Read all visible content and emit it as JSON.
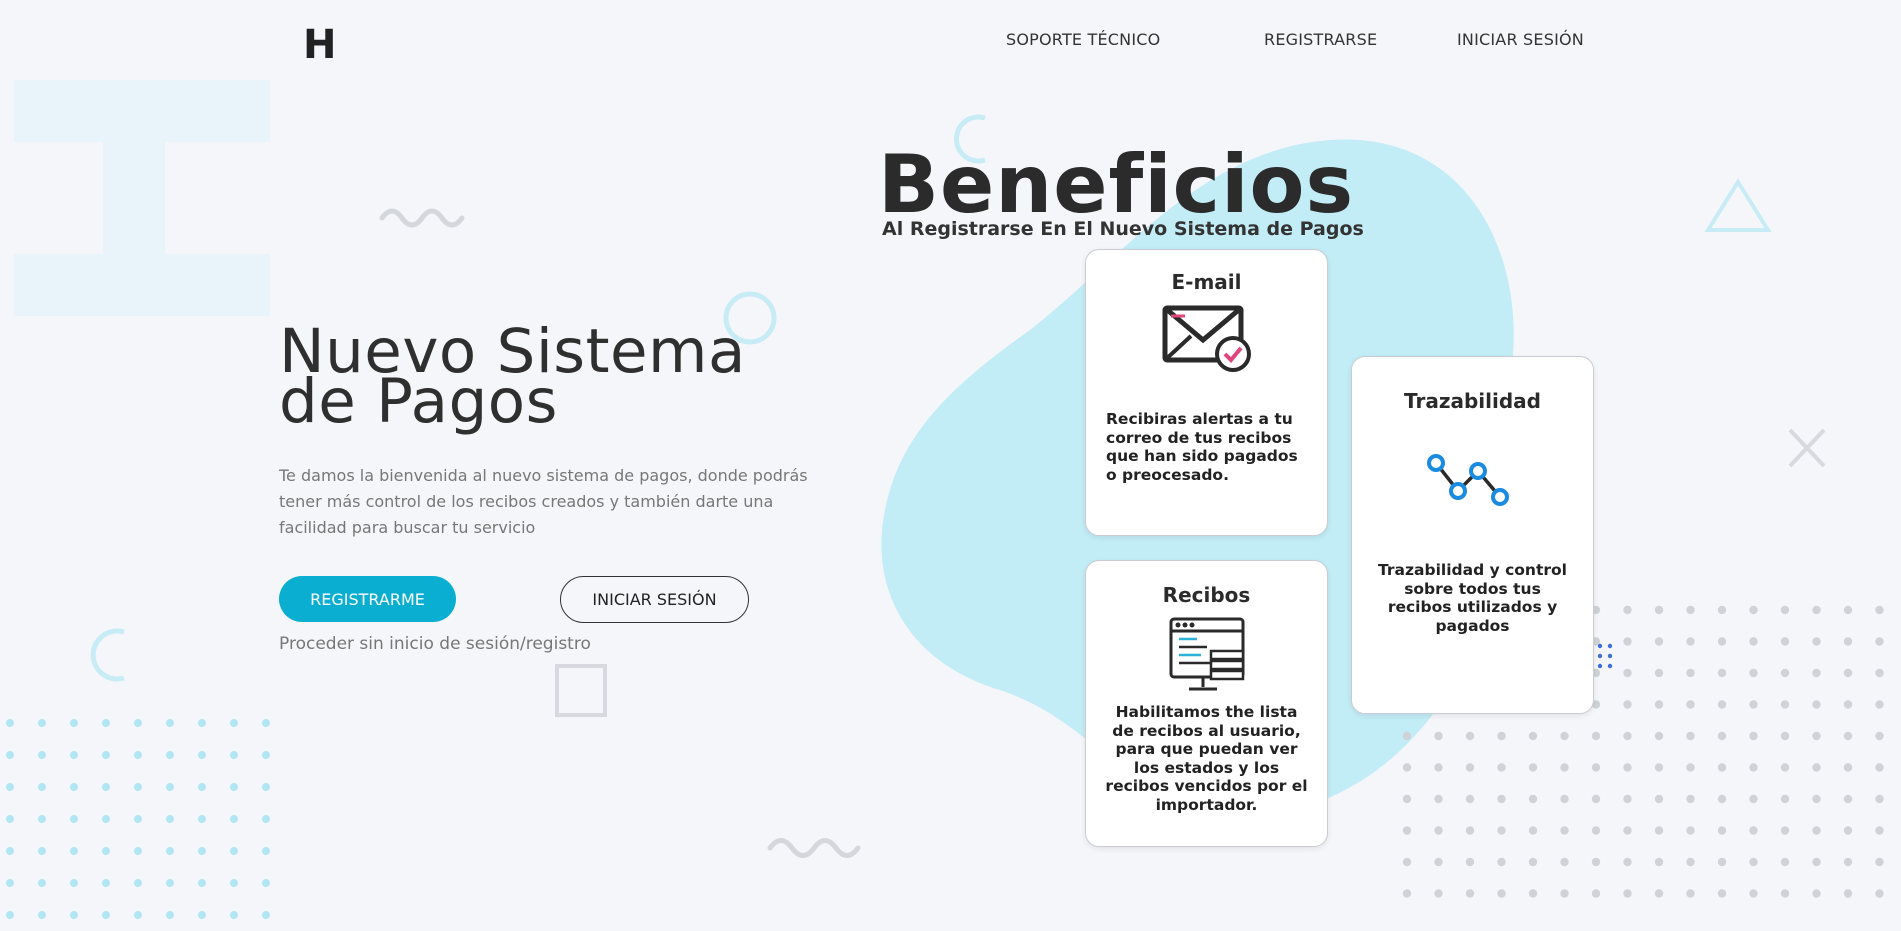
{
  "header": {
    "logo": "H",
    "nav": [
      {
        "label": "SOPORTE TÉCNICO"
      },
      {
        "label": "REGISTRARSE"
      },
      {
        "label": "INICIAR SESIÓN"
      }
    ]
  },
  "hero": {
    "title_line1": "Nuevo Sistema",
    "title_line2": "de Pagos",
    "description": "Te damos la bienvenida al nuevo sistema de pagos, donde podrás tener más control de los recibos creados y también darte una facilidad para buscar tu servicio",
    "primary_button": "REGISTRARME",
    "secondary_button": "INICIAR SESIÓN",
    "proceed_link": "Proceder sin inicio de sesión/registro"
  },
  "benefits": {
    "title": "Beneficios",
    "subtitle": "Al Registrarse En El Nuevo Sistema de Pagos",
    "cards": [
      {
        "title": "E-mail",
        "icon": "email-check-icon",
        "text": "Recibiras alertas a tu correo de tus recibos que han sido pagados o preocesado."
      },
      {
        "title": "Trazabilidad",
        "icon": "trace-line-icon",
        "text": "Trazabilidad y control sobre todos tus recibos utilizados y pagados"
      },
      {
        "title": "Recibos",
        "icon": "receipts-monitor-icon",
        "text": "Habilitamos the lista de recibos al usuario, para que puedan ver los estados y los recibos vencidos por el importador."
      }
    ]
  },
  "colors": {
    "accent": "#0aaed1",
    "blob": "#c2ecf6",
    "background": "#f5f6fa"
  }
}
